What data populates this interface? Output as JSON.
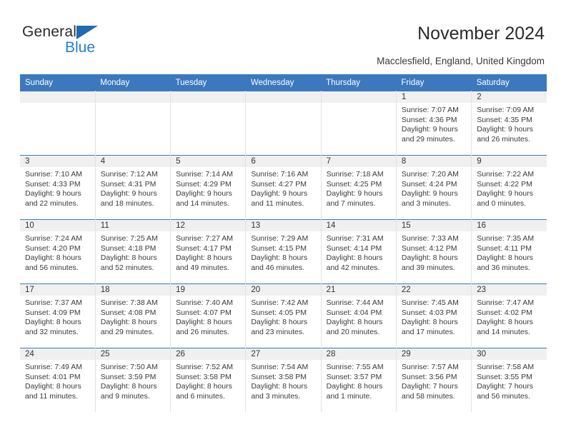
{
  "brand": {
    "name_top": "General",
    "name_bottom": "Blue",
    "triangle_color": "#1f6cb0",
    "blue_text_color": "#1f7fd4"
  },
  "header": {
    "title": "November 2024",
    "subtitle": "Macclesfield, England, United Kingdom"
  },
  "theme": {
    "header_blue": "#3b78bd",
    "daynum_band": "#f0f0f0",
    "grid_line": "#e2e2e2"
  },
  "weekdays": [
    "Sunday",
    "Monday",
    "Tuesday",
    "Wednesday",
    "Thursday",
    "Friday",
    "Saturday"
  ],
  "weeks": [
    [
      {
        "day": "",
        "lines": []
      },
      {
        "day": "",
        "lines": []
      },
      {
        "day": "",
        "lines": []
      },
      {
        "day": "",
        "lines": []
      },
      {
        "day": "",
        "lines": []
      },
      {
        "day": "1",
        "lines": [
          "Sunrise: 7:07 AM",
          "Sunset: 4:36 PM",
          "Daylight: 9 hours",
          "and 29 minutes."
        ]
      },
      {
        "day": "2",
        "lines": [
          "Sunrise: 7:09 AM",
          "Sunset: 4:35 PM",
          "Daylight: 9 hours",
          "and 26 minutes."
        ]
      }
    ],
    [
      {
        "day": "3",
        "lines": [
          "Sunrise: 7:10 AM",
          "Sunset: 4:33 PM",
          "Daylight: 9 hours",
          "and 22 minutes."
        ]
      },
      {
        "day": "4",
        "lines": [
          "Sunrise: 7:12 AM",
          "Sunset: 4:31 PM",
          "Daylight: 9 hours",
          "and 18 minutes."
        ]
      },
      {
        "day": "5",
        "lines": [
          "Sunrise: 7:14 AM",
          "Sunset: 4:29 PM",
          "Daylight: 9 hours",
          "and 14 minutes."
        ]
      },
      {
        "day": "6",
        "lines": [
          "Sunrise: 7:16 AM",
          "Sunset: 4:27 PM",
          "Daylight: 9 hours",
          "and 11 minutes."
        ]
      },
      {
        "day": "7",
        "lines": [
          "Sunrise: 7:18 AM",
          "Sunset: 4:25 PM",
          "Daylight: 9 hours",
          "and 7 minutes."
        ]
      },
      {
        "day": "8",
        "lines": [
          "Sunrise: 7:20 AM",
          "Sunset: 4:24 PM",
          "Daylight: 9 hours",
          "and 3 minutes."
        ]
      },
      {
        "day": "9",
        "lines": [
          "Sunrise: 7:22 AM",
          "Sunset: 4:22 PM",
          "Daylight: 9 hours",
          "and 0 minutes."
        ]
      }
    ],
    [
      {
        "day": "10",
        "lines": [
          "Sunrise: 7:24 AM",
          "Sunset: 4:20 PM",
          "Daylight: 8 hours",
          "and 56 minutes."
        ]
      },
      {
        "day": "11",
        "lines": [
          "Sunrise: 7:25 AM",
          "Sunset: 4:18 PM",
          "Daylight: 8 hours",
          "and 52 minutes."
        ]
      },
      {
        "day": "12",
        "lines": [
          "Sunrise: 7:27 AM",
          "Sunset: 4:17 PM",
          "Daylight: 8 hours",
          "and 49 minutes."
        ]
      },
      {
        "day": "13",
        "lines": [
          "Sunrise: 7:29 AM",
          "Sunset: 4:15 PM",
          "Daylight: 8 hours",
          "and 46 minutes."
        ]
      },
      {
        "day": "14",
        "lines": [
          "Sunrise: 7:31 AM",
          "Sunset: 4:14 PM",
          "Daylight: 8 hours",
          "and 42 minutes."
        ]
      },
      {
        "day": "15",
        "lines": [
          "Sunrise: 7:33 AM",
          "Sunset: 4:12 PM",
          "Daylight: 8 hours",
          "and 39 minutes."
        ]
      },
      {
        "day": "16",
        "lines": [
          "Sunrise: 7:35 AM",
          "Sunset: 4:11 PM",
          "Daylight: 8 hours",
          "and 36 minutes."
        ]
      }
    ],
    [
      {
        "day": "17",
        "lines": [
          "Sunrise: 7:37 AM",
          "Sunset: 4:09 PM",
          "Daylight: 8 hours",
          "and 32 minutes."
        ]
      },
      {
        "day": "18",
        "lines": [
          "Sunrise: 7:38 AM",
          "Sunset: 4:08 PM",
          "Daylight: 8 hours",
          "and 29 minutes."
        ]
      },
      {
        "day": "19",
        "lines": [
          "Sunrise: 7:40 AM",
          "Sunset: 4:07 PM",
          "Daylight: 8 hours",
          "and 26 minutes."
        ]
      },
      {
        "day": "20",
        "lines": [
          "Sunrise: 7:42 AM",
          "Sunset: 4:05 PM",
          "Daylight: 8 hours",
          "and 23 minutes."
        ]
      },
      {
        "day": "21",
        "lines": [
          "Sunrise: 7:44 AM",
          "Sunset: 4:04 PM",
          "Daylight: 8 hours",
          "and 20 minutes."
        ]
      },
      {
        "day": "22",
        "lines": [
          "Sunrise: 7:45 AM",
          "Sunset: 4:03 PM",
          "Daylight: 8 hours",
          "and 17 minutes."
        ]
      },
      {
        "day": "23",
        "lines": [
          "Sunrise: 7:47 AM",
          "Sunset: 4:02 PM",
          "Daylight: 8 hours",
          "and 14 minutes."
        ]
      }
    ],
    [
      {
        "day": "24",
        "lines": [
          "Sunrise: 7:49 AM",
          "Sunset: 4:01 PM",
          "Daylight: 8 hours",
          "and 11 minutes."
        ]
      },
      {
        "day": "25",
        "lines": [
          "Sunrise: 7:50 AM",
          "Sunset: 3:59 PM",
          "Daylight: 8 hours",
          "and 9 minutes."
        ]
      },
      {
        "day": "26",
        "lines": [
          "Sunrise: 7:52 AM",
          "Sunset: 3:58 PM",
          "Daylight: 8 hours",
          "and 6 minutes."
        ]
      },
      {
        "day": "27",
        "lines": [
          "Sunrise: 7:54 AM",
          "Sunset: 3:58 PM",
          "Daylight: 8 hours",
          "and 3 minutes."
        ]
      },
      {
        "day": "28",
        "lines": [
          "Sunrise: 7:55 AM",
          "Sunset: 3:57 PM",
          "Daylight: 8 hours",
          "and 1 minute."
        ]
      },
      {
        "day": "29",
        "lines": [
          "Sunrise: 7:57 AM",
          "Sunset: 3:56 PM",
          "Daylight: 7 hours",
          "and 58 minutes."
        ]
      },
      {
        "day": "30",
        "lines": [
          "Sunrise: 7:58 AM",
          "Sunset: 3:55 PM",
          "Daylight: 7 hours",
          "and 56 minutes."
        ]
      }
    ]
  ]
}
